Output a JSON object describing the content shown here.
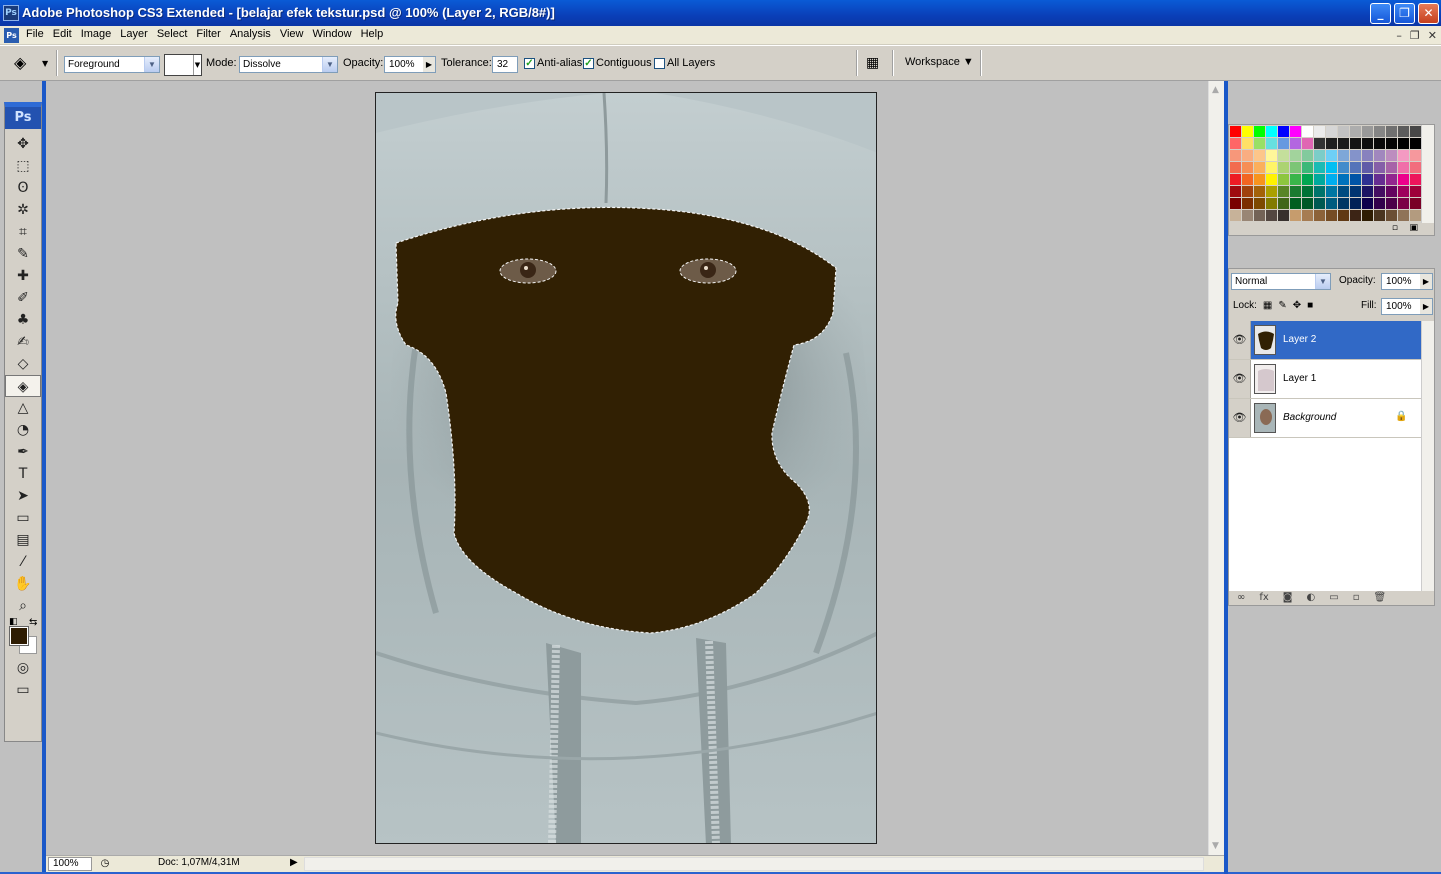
{
  "window": {
    "title": "Adobe Photoshop CS3 Extended - [belajar efek tekstur.psd @ 100% (Layer 2, RGB/8#)]",
    "app_icon": "Ps",
    "min": "_",
    "max": "❐",
    "close": "✕"
  },
  "menu": {
    "doc_icon": "Ps",
    "items": [
      "File",
      "Edit",
      "Image",
      "Layer",
      "Select",
      "Filter",
      "Analysis",
      "View",
      "Window",
      "Help"
    ],
    "mdi": [
      "–",
      "❐",
      "✕"
    ]
  },
  "options": {
    "fill_source": "Foreground",
    "mode_label": "Mode:",
    "mode_value": "Dissolve",
    "opacity_label": "Opacity:",
    "opacity_value": "100%",
    "tolerance_label": "Tolerance:",
    "tolerance_value": "32",
    "antialias_label": "Anti-alias",
    "antialias_checked": true,
    "contiguous_label": "Contiguous",
    "contiguous_checked": true,
    "all_layers_label": "All Layers",
    "all_layers_checked": false,
    "workspace_label": "Workspace ▼"
  },
  "toolbox": {
    "logo": "Ps",
    "tools": [
      {
        "icon": "move-icon",
        "glyph": "✥"
      },
      {
        "icon": "marquee-icon",
        "glyph": "⬚"
      },
      {
        "icon": "lasso-icon",
        "glyph": "ʘ"
      },
      {
        "icon": "magic-wand-icon",
        "glyph": "✲"
      },
      {
        "icon": "crop-icon",
        "glyph": "⌗"
      },
      {
        "icon": "slice-icon",
        "glyph": "✎"
      },
      {
        "icon": "healing-brush-icon",
        "glyph": "✚"
      },
      {
        "icon": "brush-icon",
        "glyph": "✐"
      },
      {
        "icon": "clone-stamp-icon",
        "glyph": "♣"
      },
      {
        "icon": "history-brush-icon",
        "glyph": "✍"
      },
      {
        "icon": "eraser-icon",
        "glyph": "◇"
      },
      {
        "icon": "paint-bucket-icon",
        "glyph": "◈",
        "active": true
      },
      {
        "icon": "blur-icon",
        "glyph": "△"
      },
      {
        "icon": "dodge-icon",
        "glyph": "◔"
      },
      {
        "icon": "pen-icon",
        "glyph": "✒"
      },
      {
        "icon": "type-icon",
        "glyph": "T"
      },
      {
        "icon": "path-selection-icon",
        "glyph": "➤"
      },
      {
        "icon": "shape-icon",
        "glyph": "▭"
      },
      {
        "icon": "notes-icon",
        "glyph": "▤"
      },
      {
        "icon": "eyedropper-icon",
        "glyph": "⁄"
      },
      {
        "icon": "hand-icon",
        "glyph": "✋"
      },
      {
        "icon": "zoom-icon",
        "glyph": "⌕"
      }
    ],
    "fg_color": "#2e1c02",
    "bg_color": "#ffffff"
  },
  "status": {
    "zoom": "100%",
    "doc_info": "Doc: 1,07M/4,31M"
  },
  "layers_panel": {
    "blend_mode": "Normal",
    "opacity_label": "Opacity:",
    "opacity_value": "100%",
    "lock_label": "Lock:",
    "fill_label": "Fill:",
    "fill_value": "100%",
    "layers": [
      {
        "name": "Layer 2",
        "selected": true,
        "visible": true
      },
      {
        "name": "Layer 1",
        "selected": false,
        "visible": true
      },
      {
        "name": "Background",
        "selected": false,
        "visible": true,
        "locked": true
      }
    ]
  },
  "colors": {
    "fill_brown": "#312003",
    "hoodie": "#aab8bb",
    "accent": "#3169c6"
  }
}
